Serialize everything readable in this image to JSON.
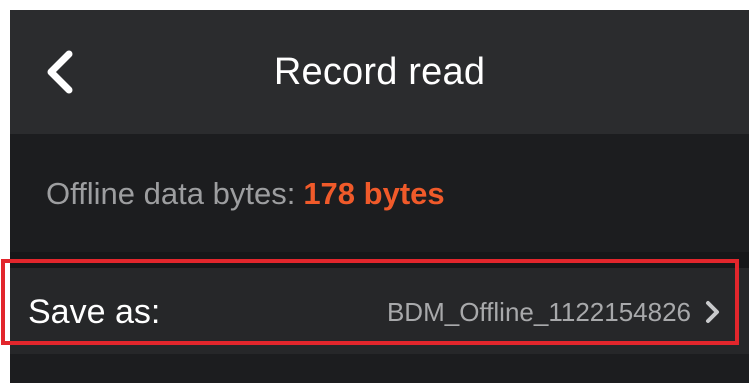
{
  "header": {
    "title": "Record read",
    "back_icon": "chevron-left-icon"
  },
  "info": {
    "label": "Offline data bytes:",
    "value": "178 bytes",
    "value_color": "#f05a2a"
  },
  "save_row": {
    "label": "Save as:",
    "value": "BDM_Offline_1122154826",
    "chevron_icon": "chevron-right-icon"
  },
  "colors": {
    "header_bg": "#2b2c2e",
    "body_bg": "#1c1d1f",
    "row_bg": "#262729",
    "highlight": "#e2262c"
  }
}
